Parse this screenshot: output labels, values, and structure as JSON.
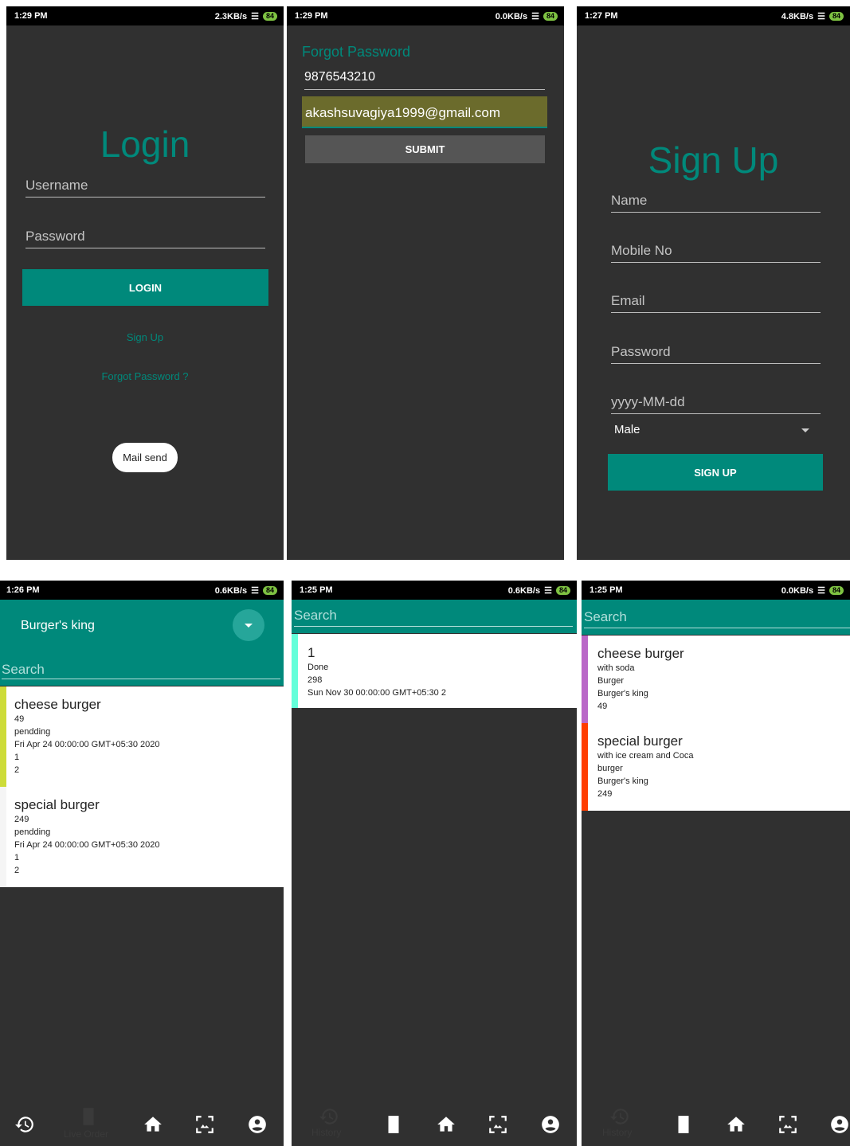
{
  "status": {
    "s1": {
      "time": "1:29 PM",
      "speed": "2.3KB/s",
      "battery": "84"
    },
    "s2": {
      "time": "1:29 PM",
      "speed": "0.0KB/s",
      "battery": "84"
    },
    "s3": {
      "time": "1:27 PM",
      "speed": "4.8KB/s",
      "battery": "84"
    },
    "s4": {
      "time": "1:26 PM",
      "speed": "0.6KB/s",
      "battery": "84"
    },
    "s5": {
      "time": "1:25 PM",
      "speed": "0.6KB/s",
      "battery": "84"
    },
    "s6": {
      "time": "1:25 PM",
      "speed": "0.0KB/s",
      "battery": "84"
    }
  },
  "login": {
    "title": "Login",
    "username_placeholder": "Username",
    "password_placeholder": "Password",
    "login_button": "LOGIN",
    "signup_link": "Sign Up",
    "forgot_link": "Forgot Password ?",
    "toast": "Mail send"
  },
  "forgot": {
    "title": "Forgot Password",
    "phone_value": "9876543210",
    "email_value": "akashsuvagiya1999@gmail.com",
    "submit_button": "SUBMIT"
  },
  "signup": {
    "title": "Sign Up",
    "name_placeholder": "Name",
    "mobile_placeholder": "Mobile No",
    "email_placeholder": "Email",
    "password_placeholder": "Password",
    "date_placeholder": "yyyy-MM-dd",
    "gender_selected": "Male",
    "signup_button": "SIGN UP"
  },
  "orders": {
    "restaurant": "Burger's king",
    "search_placeholder": "Search",
    "items": [
      {
        "name": "cheese burger",
        "price": "49",
        "status": "pendding",
        "date": "Fri Apr 24 00:00:00 GMT+05:30 2020",
        "qty": "1",
        "extra": "2"
      },
      {
        "name": "special burger",
        "price": "249",
        "status": "pendding",
        "date": "Fri Apr 24 00:00:00 GMT+05:30 2020",
        "qty": "1",
        "extra": "2"
      }
    ],
    "nav_label": "Live Order"
  },
  "history": {
    "search_placeholder": "Search",
    "item": {
      "id": "1",
      "status": "Done",
      "amount": "298",
      "date": "Sun Nov 30 00:00:00 GMT+05:30 2"
    },
    "nav_label": "History"
  },
  "menu": {
    "search_placeholder": "Search",
    "items": [
      {
        "name": "cheese burger",
        "desc": "with soda",
        "category": "Burger",
        "shop": "Burger's king",
        "price": "49"
      },
      {
        "name": "special burger",
        "desc": "with ice cream and Coca",
        "category": "burger",
        "shop": "Burger's king",
        "price": "249"
      }
    ],
    "nav_label": "History"
  },
  "colors": {
    "teal": "#00897b",
    "bg": "#303030",
    "stripe_lime": "#cddc39",
    "stripe_aqua": "#64ffda",
    "stripe_purple": "#ba68c8",
    "stripe_red": "#ff3d00"
  }
}
